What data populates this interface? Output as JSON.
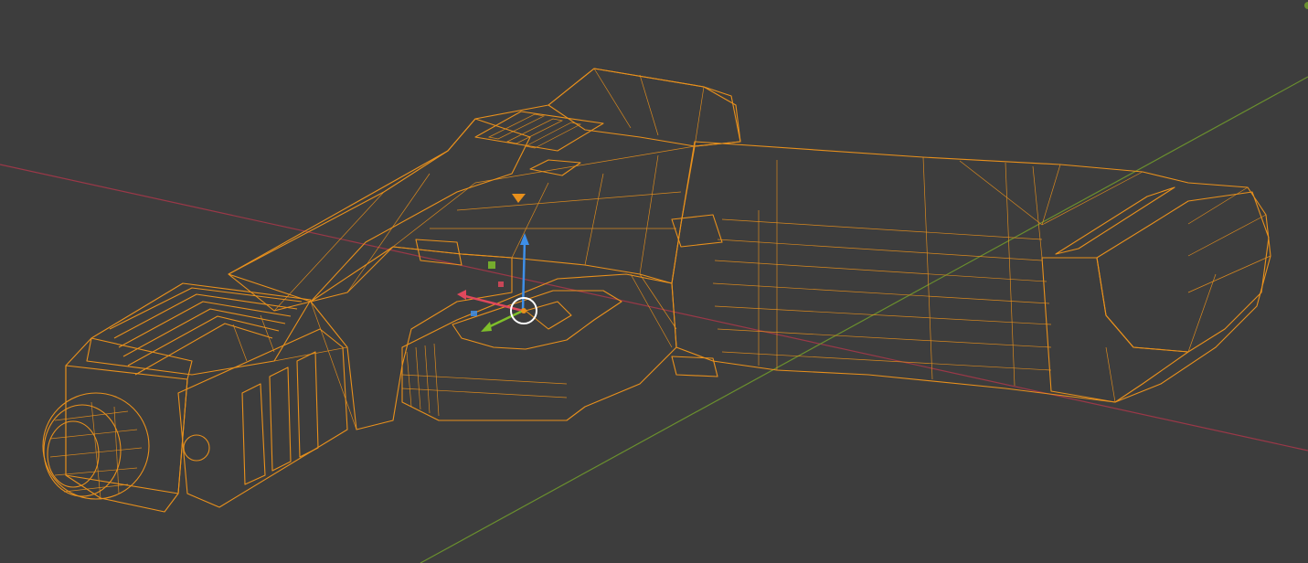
{
  "viewport": {
    "mode": "edit-wireframe-overlay",
    "colors": {
      "background": "#3d3d3d",
      "mesh_fill": "#a9a9a9",
      "mesh_shadow": "#7c7c7c",
      "mesh_highlight": "#c4c4c4",
      "wire": "#e8901c",
      "x_axis": "#9a3848",
      "y_axis": "#6a8f2e",
      "gizmo_x": "#e0485c",
      "gizmo_y": "#7fbf2a",
      "gizmo_z": "#3e8fe8",
      "gizmo_center": "#ffffff"
    },
    "object": {
      "name_icon": "pistol-mesh-icon",
      "selected": true
    },
    "gizmo": {
      "type": "transform-3d-cursor"
    }
  }
}
